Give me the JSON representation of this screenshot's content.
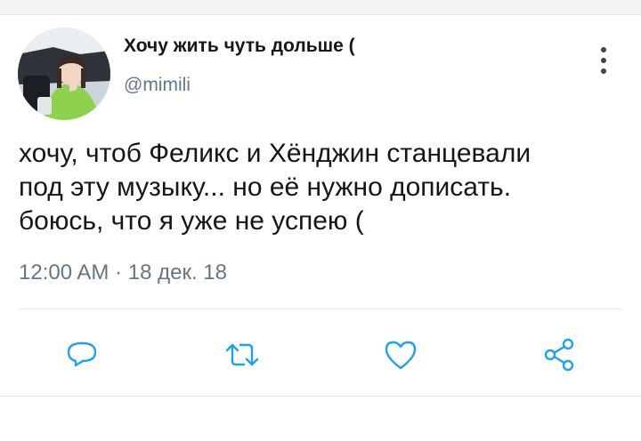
{
  "tweet": {
    "display_name": "Хочу жить чуть дольше (",
    "handle": "@mimili",
    "text_lines": [
      "хочу, чтоб Феликс и Хёнджин станцевали",
      "под эту музыку... но её нужно дописать.",
      "боюсь, что я уже не успею ("
    ],
    "time": "12:00 AM",
    "separator": "·",
    "date": "18 дек. 18"
  },
  "icons": {
    "more": "more-vertical-icon",
    "reply": "reply-bubble-icon",
    "retweet": "retweet-icon",
    "like": "heart-icon",
    "share": "share-icon"
  },
  "colors": {
    "text": "#14171a",
    "secondary": "#657786",
    "icon_blue": "#1da1f2",
    "divider": "#e1e4e8",
    "top_bar": "#f3f4f6"
  }
}
